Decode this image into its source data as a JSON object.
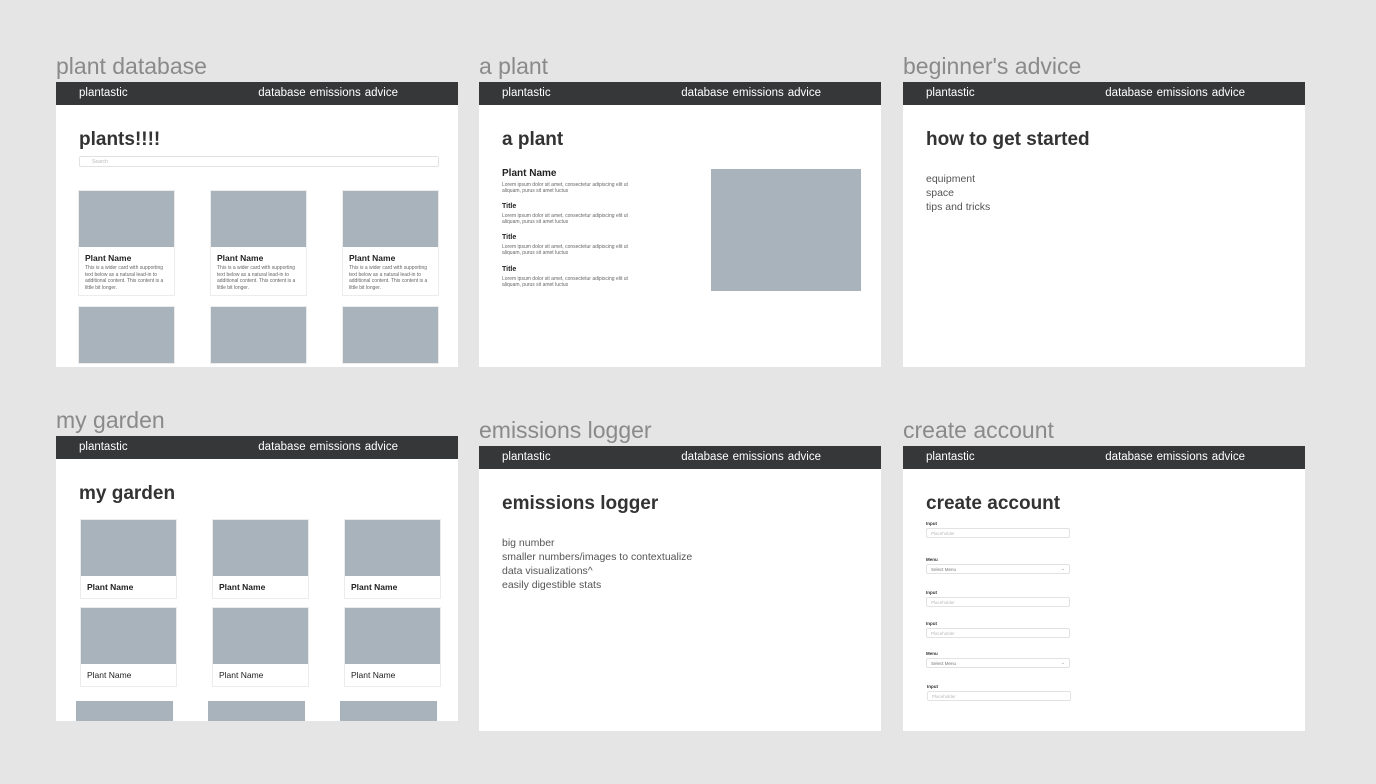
{
  "nav": {
    "brand": "plantastic",
    "links": [
      "database",
      "emissions",
      "advice"
    ]
  },
  "frames": {
    "database": {
      "label": "plant database",
      "heading": "plants!!!!",
      "search_placeholder": "Search",
      "cards": [
        {
          "title": "Plant Name",
          "text": "This is a wider card with supporting text below as a natural lead-in to additional content. This content is a little bit longer."
        },
        {
          "title": "Plant Name",
          "text": "This is a wider card with supporting text below as a natural lead-in to additional content. This content is a little bit longer."
        },
        {
          "title": "Plant Name",
          "text": "This is a wider card with supporting text below as a natural lead-in to additional content. This content is a little bit longer."
        }
      ]
    },
    "plant": {
      "label": "a plant",
      "heading": "a plant",
      "plant_name": "Plant Name",
      "lorem": "Lorem ipsum dolor sit amet, consectetur adipiscing elit ut aliquam, purus sit amet luctus",
      "section_title": "Title"
    },
    "advice": {
      "label": "beginner's advice",
      "heading": "how to get started",
      "items": [
        "equipment",
        "space",
        "tips and tricks"
      ]
    },
    "garden": {
      "label": "my garden",
      "heading": "my garden",
      "card_title": "Plant Name"
    },
    "emissions": {
      "label": "emissions logger",
      "heading": "emissions logger",
      "items": [
        "big number",
        "smaller numbers/images to contextualize",
        "data visualizations^",
        "easily digestible stats"
      ]
    },
    "account": {
      "label": "create account",
      "heading": "create account",
      "fields": [
        {
          "label": "Input",
          "placeholder": "Placeholder"
        },
        {
          "label": "Menu",
          "placeholder": "Select Menu"
        },
        {
          "label": "Input",
          "placeholder": "Placeholder"
        },
        {
          "label": "Input",
          "placeholder": "Placeholder"
        },
        {
          "label": "Menu",
          "placeholder": "Select Menu"
        },
        {
          "label": "Input",
          "placeholder": "Placeholder"
        }
      ]
    }
  }
}
